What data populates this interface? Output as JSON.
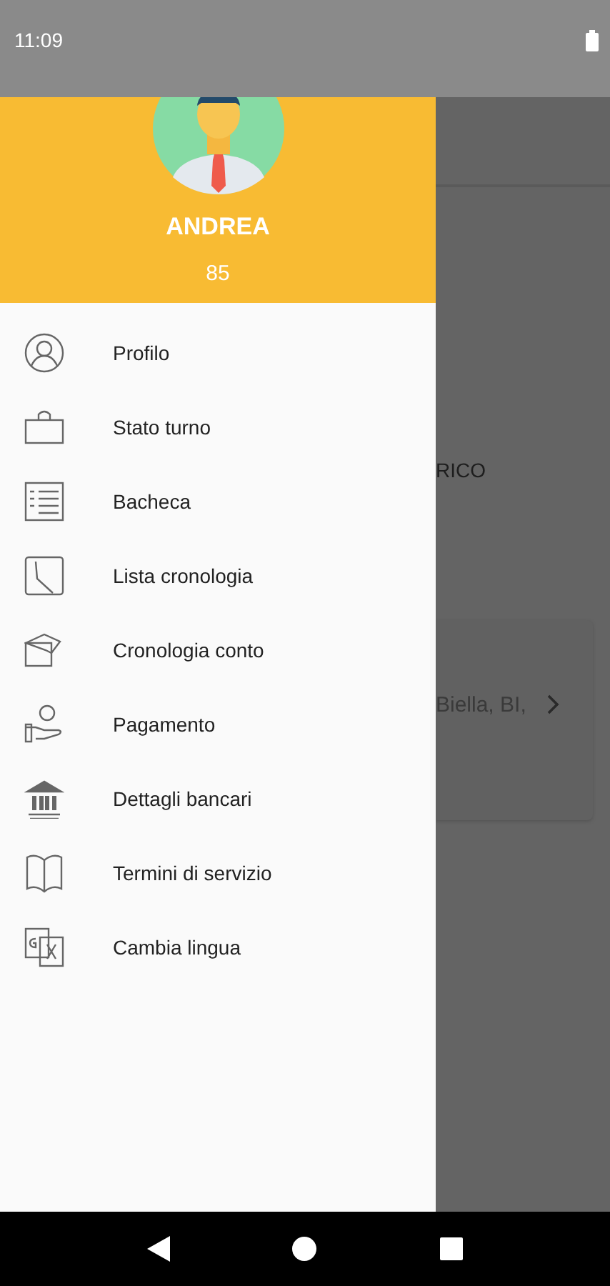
{
  "status_bar": {
    "time": "11:09"
  },
  "background_screen": {
    "text": "RICO",
    "card": {
      "text": "Biella, BI,"
    }
  },
  "drawer": {
    "header": {
      "name": "ANDREA",
      "points": "85"
    },
    "items": [
      {
        "label": "Profilo"
      },
      {
        "label": "Stato turno"
      },
      {
        "label": "Bacheca"
      },
      {
        "label": "Lista cronologia"
      },
      {
        "label": "Cronologia conto"
      },
      {
        "label": "Pagamento"
      },
      {
        "label": "Dettagli bancari"
      },
      {
        "label": "Termini di servizio"
      },
      {
        "label": "Cambia lingua"
      }
    ]
  }
}
